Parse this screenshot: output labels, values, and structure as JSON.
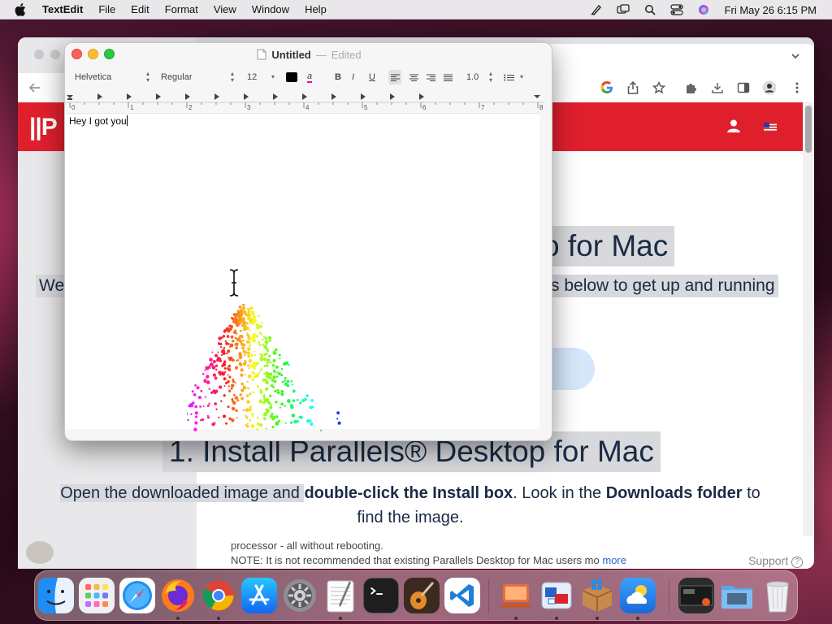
{
  "menubar": {
    "app_name": "TextEdit",
    "items": [
      "File",
      "Edit",
      "Format",
      "View",
      "Window",
      "Help"
    ],
    "clock": "Fri May 26  6:15 PM",
    "status_icons": [
      "pen-icon",
      "screen-mirror-icon",
      "search-icon",
      "control-center-icon",
      "siri-icon"
    ]
  },
  "textedit": {
    "title": "Untitled",
    "separator": "—",
    "status": "Edited",
    "font_family": "Helvetica",
    "font_style": "Regular",
    "font_size": "12",
    "line_spacing": "1.0",
    "text_color": "#000000",
    "content": "Hey I got you",
    "ruler_marks": [
      "0",
      "1",
      "2",
      "3",
      "4",
      "5",
      "6",
      "7",
      "8"
    ],
    "format_buttons": {
      "bold": "B",
      "italic": "I",
      "underline": "U"
    }
  },
  "browser": {
    "logo": "||P",
    "heading1": "o for Mac",
    "para1_left": "We",
    "para1_right": "s below to get up and running",
    "heading2": "1. Install Parallels® Desktop for Mac",
    "para2": {
      "t1": "Open the downloaded image and ",
      "b1": "double-click the Install box",
      "t2": ". Look in the ",
      "b2": "Downloads folder",
      "t3": " to",
      "line2": "find the image."
    },
    "lower": {
      "line1": "processor - all without rebooting.",
      "line2": "NOTE: It is not recommended that existing Parallels Desktop for Mac users mo",
      "more": "more",
      "support": "Support"
    },
    "brand_color": "#e01f2d"
  },
  "dock": {
    "items": [
      {
        "name": "finder",
        "icon": "finder-icon",
        "running": true
      },
      {
        "name": "launchpad",
        "icon": "launchpad-icon",
        "running": false
      },
      {
        "name": "safari",
        "icon": "safari-icon",
        "running": false
      },
      {
        "name": "firefox",
        "icon": "firefox-icon",
        "running": true
      },
      {
        "name": "chrome",
        "icon": "chrome-icon",
        "running": true
      },
      {
        "name": "app-store",
        "icon": "app-store-icon",
        "running": false
      },
      {
        "name": "system-preferences",
        "icon": "gear-icon",
        "running": false
      },
      {
        "name": "textedit",
        "icon": "textedit-icon",
        "running": true
      },
      {
        "name": "terminal",
        "icon": "terminal-icon",
        "running": false
      },
      {
        "name": "garageband",
        "icon": "guitar-icon",
        "running": false
      },
      {
        "name": "vscode",
        "icon": "vscode-icon",
        "running": false
      },
      {
        "name": "parallels-laptop",
        "icon": "laptop-icon",
        "running": true
      },
      {
        "name": "parallels-desktop",
        "icon": "parallels-icon",
        "running": true
      },
      {
        "name": "windows-box",
        "icon": "windows-box-icon",
        "running": true
      },
      {
        "name": "weather",
        "icon": "weather-icon",
        "running": true
      },
      {
        "name": "screenshot-thumb",
        "icon": "screenshot-icon",
        "running": false
      },
      {
        "name": "downloads",
        "icon": "folder-icon",
        "running": false
      },
      {
        "name": "trash",
        "icon": "trash-icon",
        "running": false
      }
    ]
  }
}
